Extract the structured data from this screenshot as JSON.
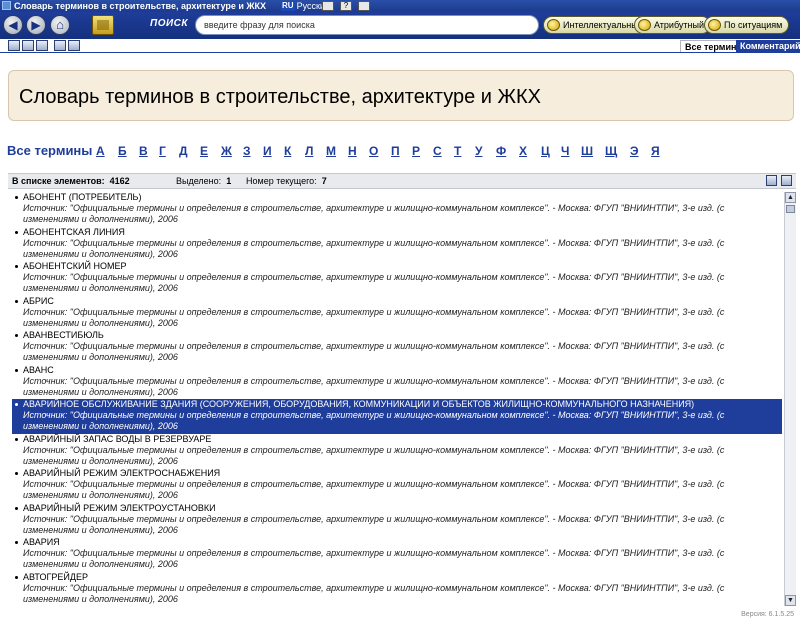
{
  "window": {
    "title": "Словарь терминов в строительстве, архитектуре и ЖКХ",
    "lang_code": "RU",
    "lang_name": "Русский",
    "mini_help": "?"
  },
  "toolbar": {
    "search_label": "ПОИСК",
    "search_placeholder": "введите фразу для поиска",
    "buttons": [
      "Интеллектуальный",
      "Атрибутный",
      "По ситуациям"
    ]
  },
  "tabs": [
    "Все термины",
    "Комментарий"
  ],
  "page_title": "Словарь терминов в строительстве, архитектуре и ЖКХ",
  "alphabet": {
    "all_label": "Все термины",
    "letters": [
      "А",
      "Б",
      "В",
      "Г",
      "Д",
      "Е",
      "Ж",
      "З",
      "И",
      "К",
      "Л",
      "М",
      "Н",
      "О",
      "П",
      "Р",
      "С",
      "Т",
      "У",
      "Ф",
      "Х",
      "Ц",
      "Ч",
      "Ш",
      "Щ",
      "Э",
      "Я"
    ]
  },
  "status": {
    "count_label": "В списке элементов:",
    "count_value": "4162",
    "selected_label": "Выделено:",
    "selected_value": "1",
    "current_label": "Номер текущего:",
    "current_value": "7"
  },
  "source_text": "Источник: \"Официальные термины и определения в строительстве, архитектуре и жилищно-коммунальном комплексе\". - Москва: ФГУП \"ВНИИНТПИ\", 3-е изд. (с изменениями и дополнениями), 2006",
  "items": [
    {
      "term": "АБОНЕНТ (ПОТРЕБИТЕЛЬ)",
      "selected": false
    },
    {
      "term": "АБОНЕНТСКАЯ ЛИНИЯ",
      "selected": false
    },
    {
      "term": "АБОНЕНТСКИЙ НОМЕР",
      "selected": false
    },
    {
      "term": "АБРИС",
      "selected": false
    },
    {
      "term": "АВАНВЕСТИБЮЛЬ",
      "selected": false
    },
    {
      "term": "АВАНС",
      "selected": false
    },
    {
      "term": "АВАРИЙНОЕ ОБСЛУЖИВАНИЕ ЗДАНИЯ (СООРУЖЕНИЯ, ОБОРУДОВАНИЯ, КОММУНИКАЦИИ И ОБЪЕКТОВ ЖИЛИЩНО-КОММУНАЛЬНОГО НАЗНАЧЕНИЯ)",
      "selected": true
    },
    {
      "term": "АВАРИЙНЫЙ ЗАПАС ВОДЫ В РЕЗЕРВУАРЕ",
      "selected": false
    },
    {
      "term": "АВАРИЙНЫЙ РЕЖИМ ЭЛЕКТРОСНАБЖЕНИЯ",
      "selected": false
    },
    {
      "term": "АВАРИЙНЫЙ РЕЖИМ ЭЛЕКТРОУСТАНОВКИ",
      "selected": false
    },
    {
      "term": "АВАРИЯ",
      "selected": false
    },
    {
      "term": "АВТОГРЕЙДЕР",
      "selected": false
    }
  ],
  "version": "Версия: 6.1.5.25"
}
